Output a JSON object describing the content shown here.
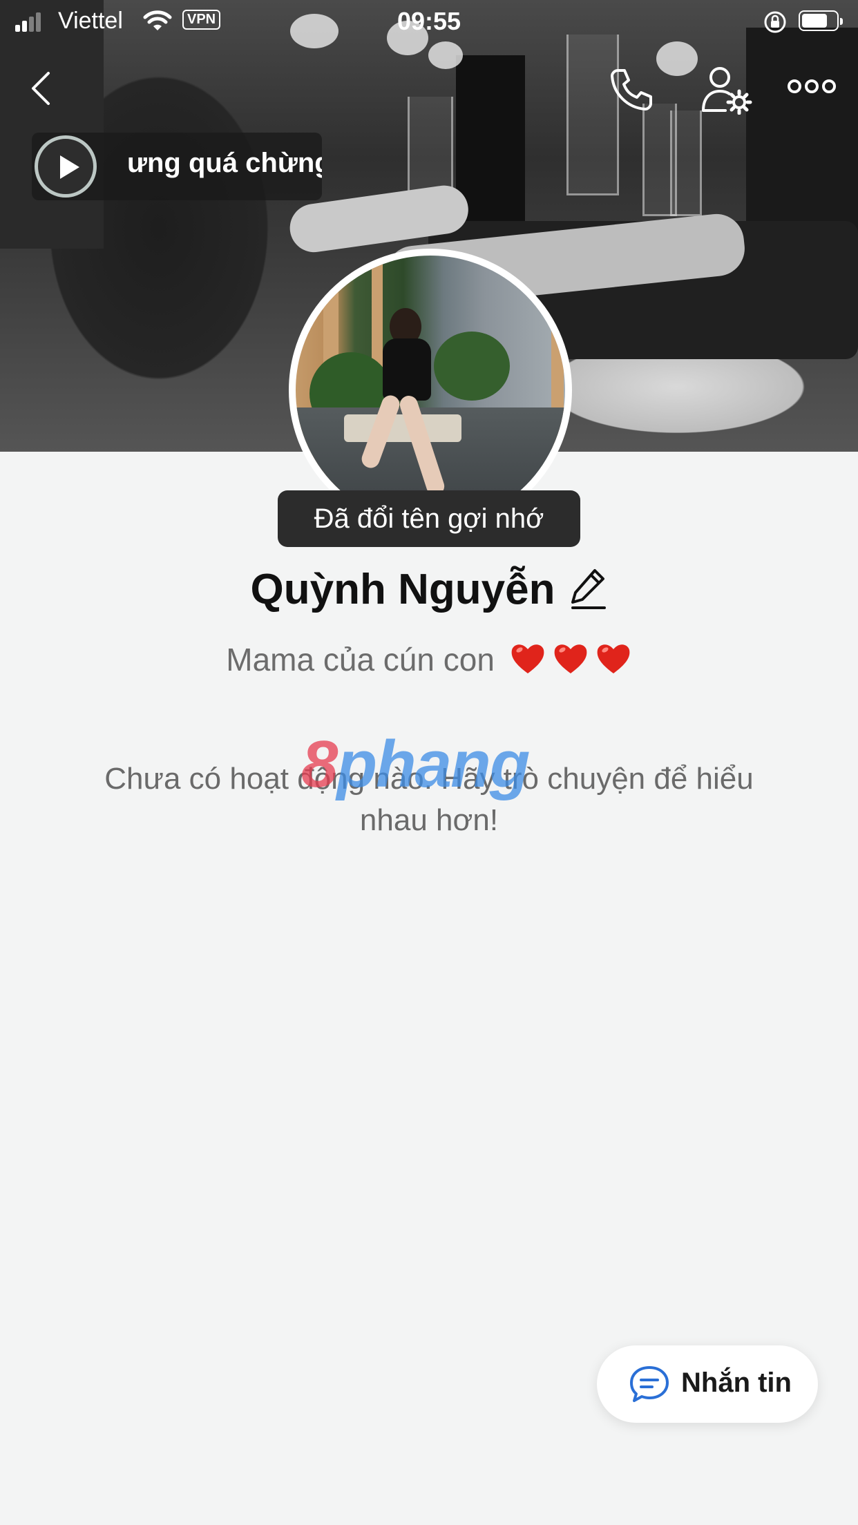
{
  "status_bar": {
    "carrier": "Viettel",
    "vpn_badge": "VPN",
    "time": "09:55",
    "battery_level": 0.75
  },
  "nav": {
    "back_icon": "chevron-left-icon",
    "call_icon": "phone-icon",
    "settings_icon": "user-settings-icon",
    "more_icon": "more-dots-icon"
  },
  "music": {
    "title": "ưng quá chừng",
    "play_icon": "play-icon"
  },
  "profile": {
    "tooltip": "Đã đổi tên gợi nhớ",
    "name": "Quỳnh Nguyễn",
    "bio": "Mama của cún con"
  },
  "activity": {
    "empty_message": "Chưa có hoạt động nào. Hãy trò chuyện để hiểu nhau hơn!"
  },
  "watermark": {
    "part1": "8",
    "part2": "phang"
  },
  "actions": {
    "message_label": "Nhắn tin"
  },
  "colors": {
    "background": "#f3f4f4",
    "message_icon": "#2a6fd6",
    "heart": "#e0241b"
  }
}
